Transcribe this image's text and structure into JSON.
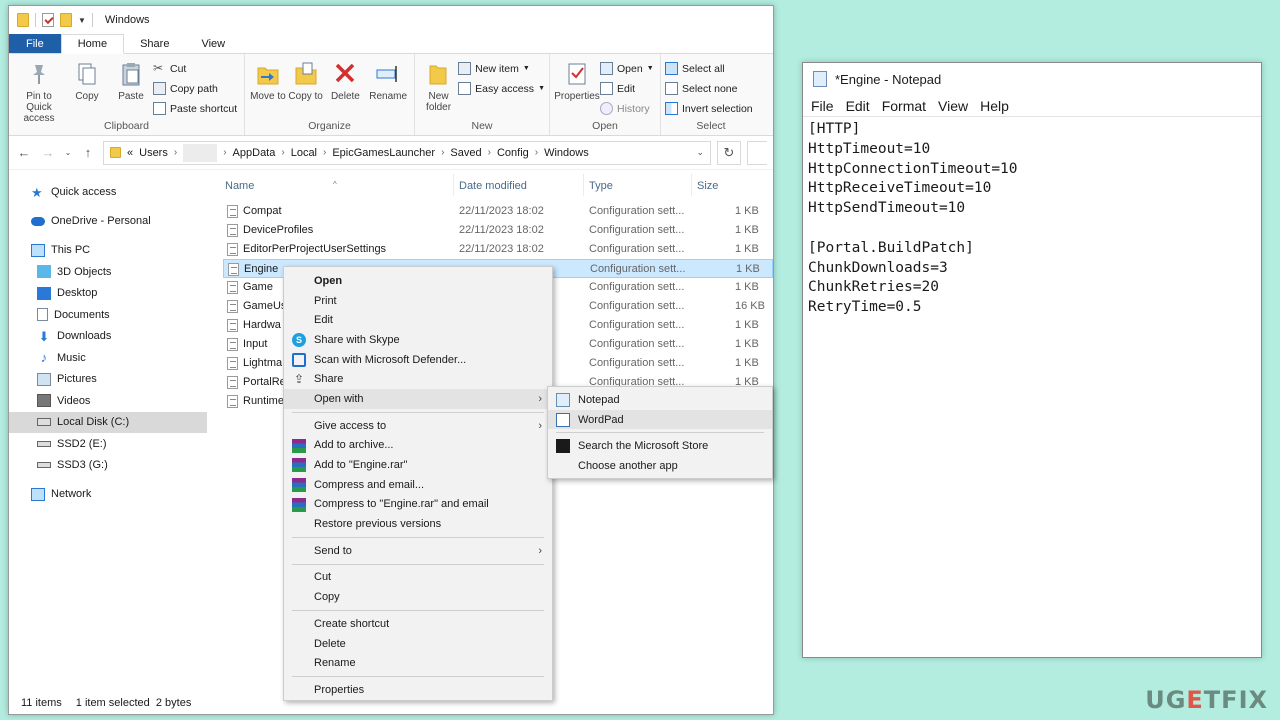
{
  "explorer": {
    "title": "Windows",
    "tabs": [
      "File",
      "Home",
      "Share",
      "View"
    ],
    "ribbon": {
      "clipboard": {
        "label": "Clipboard",
        "pin": "Pin to Quick access",
        "copy": "Copy",
        "paste": "Paste",
        "cut": "Cut",
        "copy_path": "Copy path",
        "paste_shortcut": "Paste shortcut"
      },
      "organize": {
        "label": "Organize",
        "move_to": "Move to",
        "copy_to": "Copy to",
        "delete": "Delete",
        "rename": "Rename"
      },
      "new": {
        "label": "New",
        "new_folder": "New folder",
        "new_item": "New item",
        "easy_access": "Easy access"
      },
      "open": {
        "label": "Open",
        "properties": "Properties",
        "open": "Open",
        "edit": "Edit",
        "history": "History"
      },
      "select": {
        "label": "Select",
        "select_all": "Select all",
        "select_none": "Select none",
        "invert": "Invert selection"
      }
    },
    "address": {
      "prefix": "«",
      "crumbs": [
        "Users",
        "AppData",
        "Local",
        "EpicGamesLauncher",
        "Saved",
        "Config",
        "Windows"
      ]
    },
    "sidebar": {
      "quick_access": "Quick access",
      "onedrive": "OneDrive - Personal",
      "this_pc": "This PC",
      "items": [
        "3D Objects",
        "Desktop",
        "Documents",
        "Downloads",
        "Music",
        "Pictures",
        "Videos",
        "Local Disk (C:)",
        "SSD2 (E:)",
        "SSD3 (G:)"
      ],
      "network": "Network"
    },
    "columns": {
      "name": "Name",
      "date": "Date modified",
      "type": "Type",
      "size": "Size"
    },
    "files": [
      {
        "name": "Compat",
        "date": "22/11/2023 18:02",
        "type": "Configuration sett...",
        "size": "1 KB"
      },
      {
        "name": "DeviceProfiles",
        "date": "22/11/2023 18:02",
        "type": "Configuration sett...",
        "size": "1 KB"
      },
      {
        "name": "EditorPerProjectUserSettings",
        "date": "22/11/2023 18:02",
        "type": "Configuration sett...",
        "size": "1 KB"
      },
      {
        "name": "Engine",
        "date": "",
        "type": "Configuration sett...",
        "size": "1 KB"
      },
      {
        "name": "Game",
        "date": "",
        "type": "Configuration sett...",
        "size": "1 KB"
      },
      {
        "name": "GameUs",
        "date": "",
        "type": "Configuration sett...",
        "size": "16 KB"
      },
      {
        "name": "Hardwa",
        "date": "",
        "type": "Configuration sett...",
        "size": "1 KB"
      },
      {
        "name": "Input",
        "date": "",
        "type": "Configuration sett...",
        "size": "1 KB"
      },
      {
        "name": "Lightma",
        "date": "",
        "type": "Configuration sett...",
        "size": "1 KB"
      },
      {
        "name": "PortalRe",
        "date": "",
        "type": "Configuration sett...",
        "size": "1 KB"
      },
      {
        "name": "Runtime",
        "date": "",
        "type": "",
        "size": ""
      }
    ],
    "status": {
      "count": "11 items",
      "selection": "1 item selected  2 bytes"
    }
  },
  "context_menu": {
    "open": "Open",
    "print": "Print",
    "edit": "Edit",
    "share_skype": "Share with Skype",
    "scan": "Scan with Microsoft Defender...",
    "share": "Share",
    "open_with": "Open with",
    "give_access": "Give access to",
    "add_archive": "Add to archive...",
    "add_rar": "Add to \"Engine.rar\"",
    "compress_email": "Compress and email...",
    "compress_rar_email": "Compress to \"Engine.rar\" and email",
    "restore": "Restore previous versions",
    "send_to": "Send to",
    "cut": "Cut",
    "copy": "Copy",
    "create_shortcut": "Create shortcut",
    "delete": "Delete",
    "rename": "Rename",
    "properties": "Properties"
  },
  "open_with_menu": {
    "notepad": "Notepad",
    "wordpad": "WordPad",
    "store": "Search the Microsoft Store",
    "another": "Choose another app"
  },
  "notepad": {
    "title": "*Engine - Notepad",
    "menu": [
      "File",
      "Edit",
      "Format",
      "View",
      "Help"
    ],
    "lines": [
      "[HTTP]",
      "HttpTimeout=10",
      "HttpConnectionTimeout=10",
      "HttpReceiveTimeout=10",
      "HttpSendTimeout=10",
      "",
      "[Portal.BuildPatch]",
      "ChunkDownloads=3",
      "ChunkRetries=20",
      "RetryTime=0.5"
    ]
  },
  "watermark": {
    "a": "UG",
    "b": "E",
    "c": "TFIX"
  }
}
